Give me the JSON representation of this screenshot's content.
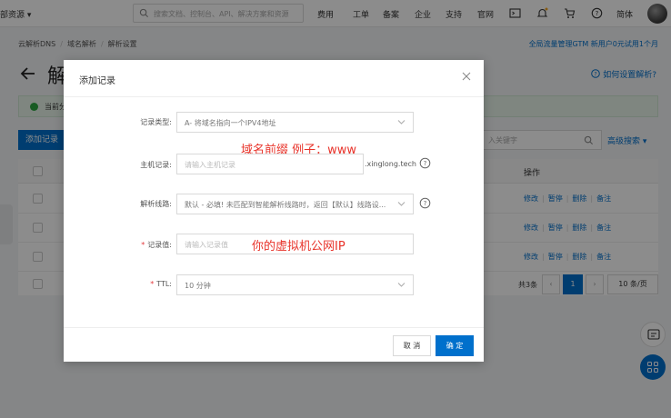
{
  "topnav": {
    "resources": "部资源 ▾",
    "search_placeholder": "搜索文档、控制台、API、解决方案和资源",
    "links": [
      "费用",
      "工单",
      "备案",
      "企业",
      "支持",
      "官网"
    ],
    "language": "简体"
  },
  "page": {
    "breadcrumb": [
      "云解析DNS",
      "域名解析",
      "解析设置"
    ],
    "promo": "全局流量管理GTM 新用户0元试用1个月",
    "title_char": "解",
    "help_link": "如何设置解析?",
    "notice_text": "当前分",
    "add_button": "添加记录",
    "keyword_placeholder": "入关键字",
    "advanced_search": "高级搜索 ▾",
    "table_header_ops": "操作",
    "row_ops": [
      "修改",
      "暂停",
      "删除",
      "备注"
    ],
    "pager_total": "共3条",
    "pager_current": "1",
    "pager_size": "10 条/页"
  },
  "modal": {
    "title": "添加记录",
    "fields": {
      "record_type_label": "记录类型:",
      "record_type_value": "A- 将域名指向一个IPV4地址",
      "host_label": "主机记录:",
      "host_placeholder": "请输入主机记录",
      "host_suffix": ".xinglong.tech",
      "line_label": "解析线路:",
      "line_value": "默认 - 必填! 未匹配到智能解析线路时，返回【默认】线路设...",
      "value_label": "记录值:",
      "value_placeholder": "请输入记录值",
      "ttl_label": "TTL:",
      "ttl_value": "10 分钟"
    },
    "annotations": {
      "host": "域名前缀 例子：www",
      "value": "你的虚拟机公网IP"
    },
    "cancel": "取 消",
    "confirm": "确 定"
  },
  "colors": {
    "primary": "#0070cc",
    "annotation": "#e8332a",
    "required": "#e4393c"
  }
}
